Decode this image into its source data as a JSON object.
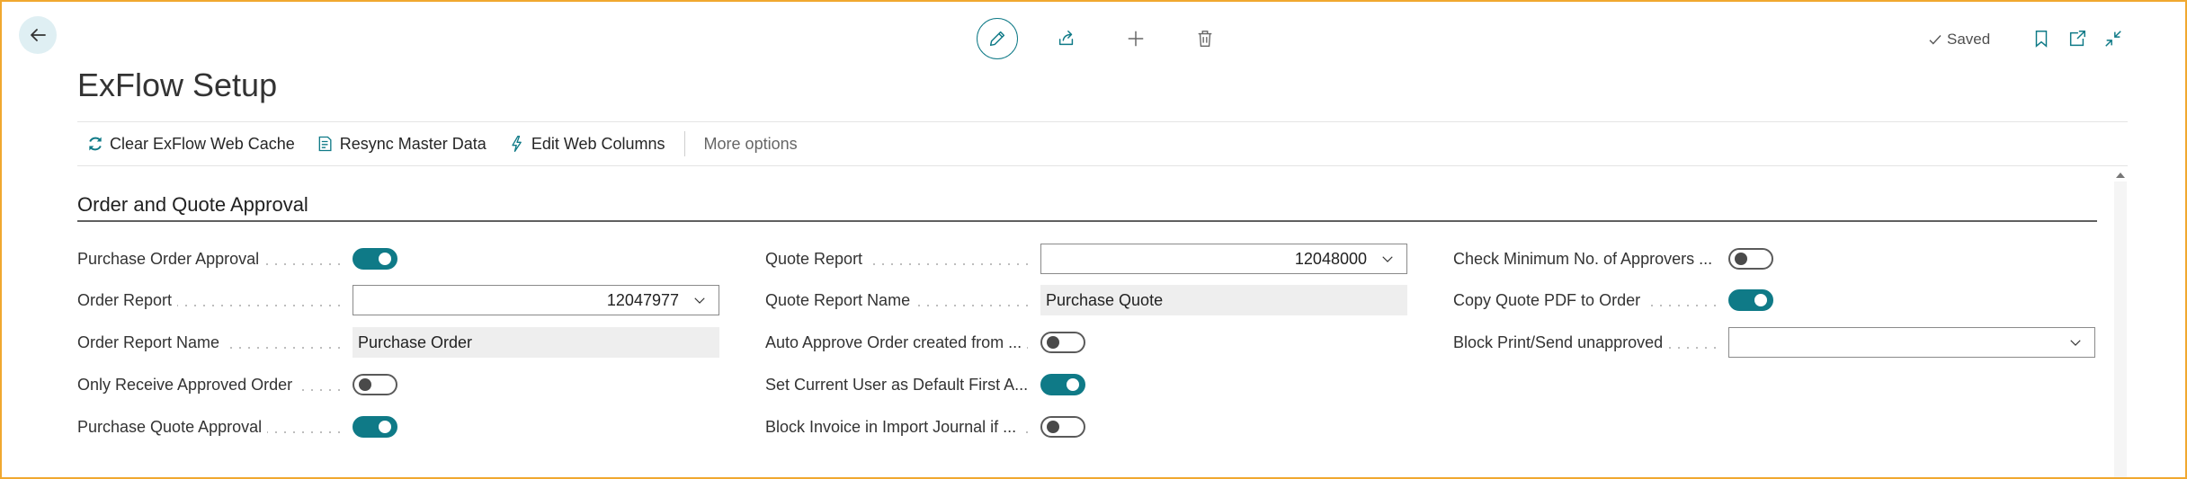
{
  "header": {
    "title": "ExFlow Setup",
    "saved_status": "Saved",
    "icons": [
      "back-arrow-icon",
      "edit-pencil-icon",
      "share-icon",
      "plus-icon",
      "trash-icon",
      "bookmark-icon",
      "open-new-window-icon",
      "collapse-icon"
    ]
  },
  "actions": {
    "clear_cache": "Clear ExFlow Web Cache",
    "resync": "Resync Master Data",
    "edit_columns": "Edit Web Columns",
    "more_options": "More options"
  },
  "section": {
    "title": "Order and Quote Approval"
  },
  "fields": {
    "col1": [
      {
        "label": "Purchase Order Approval",
        "type": "toggle",
        "value": true
      },
      {
        "label": "Order Report",
        "type": "select",
        "value": "12047977"
      },
      {
        "label": "Order Report Name",
        "type": "readonly",
        "value": "Purchase Order"
      },
      {
        "label": "Only Receive Approved Order",
        "type": "toggle",
        "value": false
      },
      {
        "label": "Purchase Quote Approval",
        "type": "toggle",
        "value": true
      }
    ],
    "col2": [
      {
        "label": "Quote Report",
        "type": "select",
        "value": "12048000"
      },
      {
        "label": "Quote Report Name",
        "type": "readonly",
        "value": "Purchase Quote"
      },
      {
        "label": "Auto Approve Order created from ...",
        "type": "toggle",
        "value": false
      },
      {
        "label": "Set Current User as Default First A...",
        "type": "toggle",
        "value": true
      },
      {
        "label": "Block Invoice in Import Journal if ...",
        "type": "toggle",
        "value": false
      }
    ],
    "col3": [
      {
        "label": "Check Minimum No. of Approvers ...",
        "type": "toggle",
        "value": false
      },
      {
        "label": "Copy Quote PDF to Order",
        "type": "toggle",
        "value": true
      },
      {
        "label": "Block Print/Send unapproved",
        "type": "select",
        "value": ""
      }
    ]
  },
  "colors": {
    "accent": "#0f7a87",
    "frame_border": "#f0a830"
  }
}
